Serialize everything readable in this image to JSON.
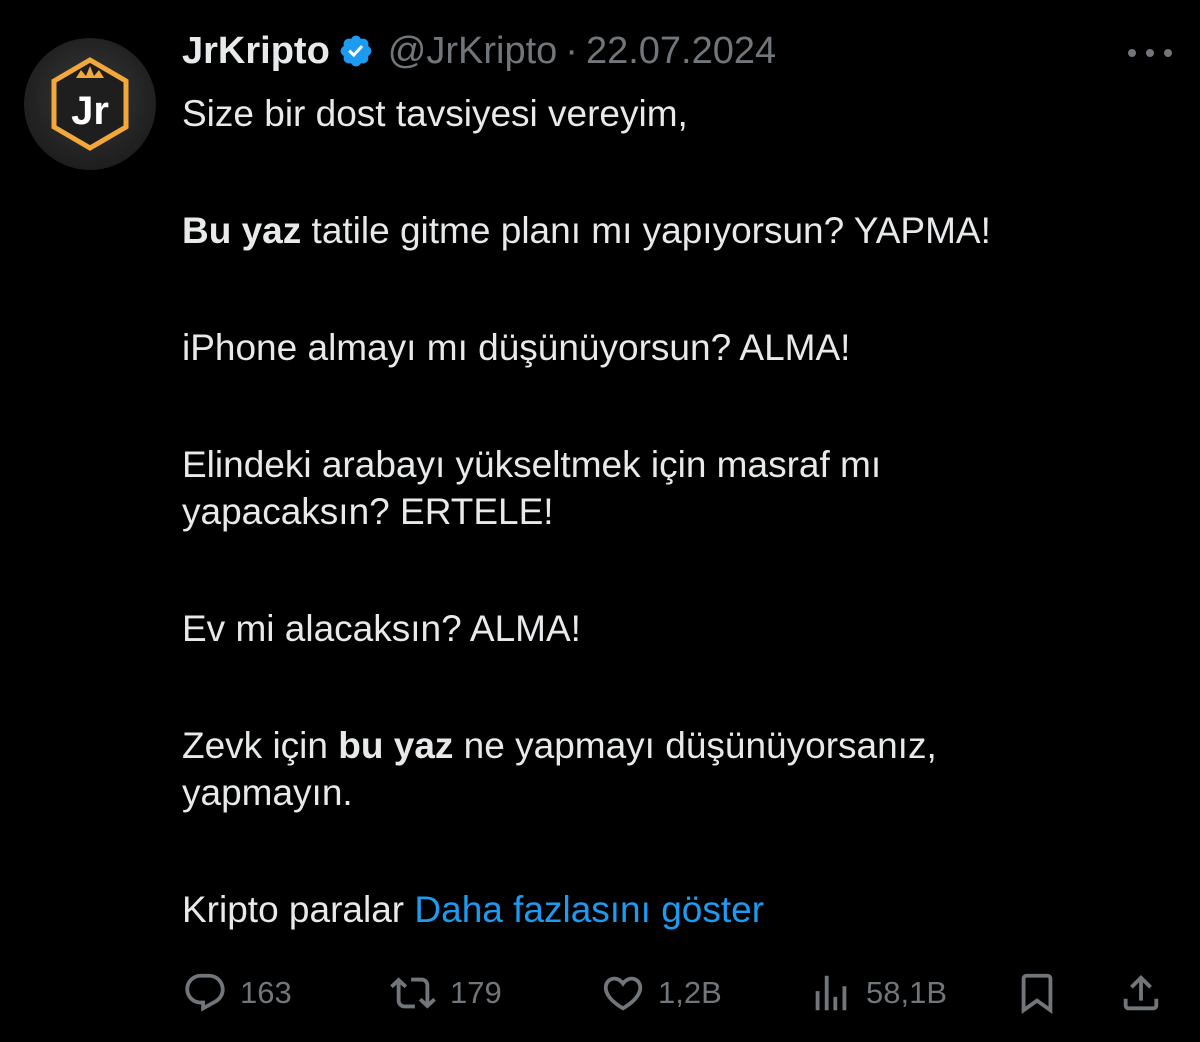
{
  "tweet": {
    "author_name": "JrKripto",
    "author_handle": "@JrKripto",
    "separator": "·",
    "date": "22.07.2024",
    "avatar_text": "Jr",
    "lines": {
      "l1": "Size bir dost tavsiyesi vereyim,",
      "l2_bold": "Bu yaz",
      "l2_rest": " tatile gitme planı mı yapıyorsun? YAPMA!",
      "l3": "iPhone almayı mı düşünüyorsun? ALMA!",
      "l4a": "Elindeki arabayı yükseltmek için masraf mı",
      "l4b": "yapacaksın? ERTELE!",
      "l5": "Ev mi alacaksın? ALMA!",
      "l6_pre": "Zevk için ",
      "l6_bold": "bu yaz",
      "l6_post": " ne yapmayı düşünüyorsanız,",
      "l6b": "yapmayın.",
      "l7": "Kripto paralar ",
      "show_more": "Daha fazlasını göster"
    },
    "actions": {
      "replies": "163",
      "reposts": "179",
      "likes": "1,2B",
      "views": "58,1B"
    }
  },
  "colors": {
    "background": "#000000",
    "text": "#e7e9ea",
    "muted": "#71767b",
    "link": "#1d9bf0",
    "verified": "#1d9bf0",
    "avatar_accent": "#f2a83a"
  },
  "icons": [
    "verified-badge-icon",
    "more-icon",
    "reply-icon",
    "repost-icon",
    "like-icon",
    "views-icon",
    "bookmark-icon",
    "share-icon"
  ]
}
